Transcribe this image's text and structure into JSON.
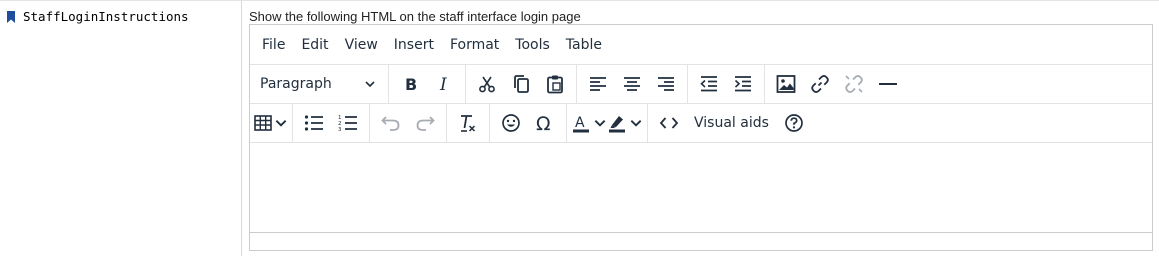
{
  "preference": {
    "name": "StaffLoginInstructions",
    "description": "Show the following HTML on the staff interface login page"
  },
  "editor": {
    "menubar": [
      "File",
      "Edit",
      "View",
      "Insert",
      "Format",
      "Tools",
      "Table"
    ],
    "block_format": "Paragraph",
    "visual_aids_label": "Visual aids",
    "content": ""
  },
  "colors": {
    "bookmark": "#1f4e9c",
    "icon": "#222f3e",
    "icon_disabled": "#a6acb3",
    "border": "#cccccc"
  }
}
